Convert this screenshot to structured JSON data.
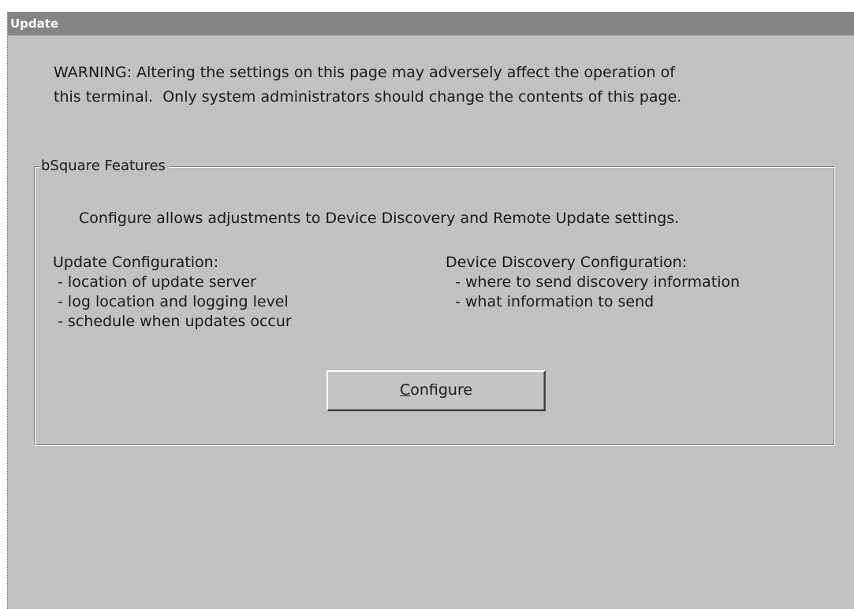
{
  "window": {
    "title": "Update"
  },
  "warning": {
    "line1": "WARNING: Altering the settings on this page may adversely affect the operation of",
    "line2": "this terminal.  Only system administrators should change the contents of this page."
  },
  "features_group": {
    "legend": "bSquare Features",
    "description": "Configure allows adjustments to Device Discovery and Remote Update settings.",
    "update_config": {
      "heading": "Update Configuration:",
      "items": [
        " - location of update server",
        " - log location and logging level",
        " - schedule when updates occur"
      ]
    },
    "discovery_config": {
      "heading": "Device Discovery Configuration:",
      "items": [
        "  - where to send discovery information",
        "  - what information to send"
      ]
    },
    "configure_button": {
      "mnemonic": "C",
      "rest": "onfigure"
    }
  }
}
